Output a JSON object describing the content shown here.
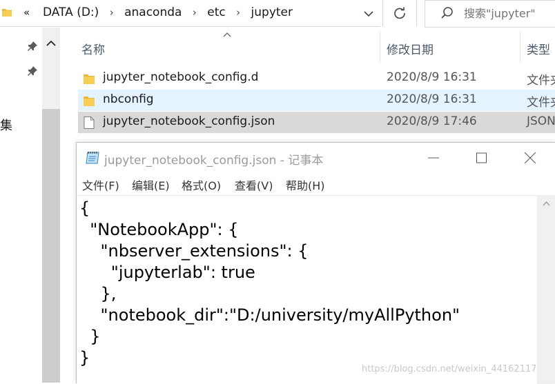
{
  "address_bar": {
    "overflow": "«",
    "path": [
      "DATA (D:)",
      "anaconda",
      "etc",
      "jupyter"
    ]
  },
  "search": {
    "placeholder": "搜索\"jupyter\""
  },
  "left_pane": {
    "label": "集"
  },
  "columns": {
    "name": "名称",
    "date": "修改日期",
    "type": "类型"
  },
  "files": [
    {
      "name": "jupyter_notebook_config.d",
      "date": "2020/8/9 16:31",
      "type": "文件夹",
      "icon": "folder-icon",
      "state": "normal"
    },
    {
      "name": "nbconfig",
      "date": "2020/8/9 16:31",
      "type": "文件夹",
      "icon": "folder-icon",
      "state": "selected"
    },
    {
      "name": "jupyter_notebook_config.json",
      "date": "2020/8/9 17:46",
      "type": "JSON",
      "icon": "file-icon",
      "state": "hover"
    }
  ],
  "notepad": {
    "title": "jupyter_notebook_config.json - 记事本",
    "menu": [
      "文件(F)",
      "编辑(E)",
      "格式(O)",
      "查看(V)",
      "帮助(H)"
    ],
    "content": [
      "{",
      "  \"NotebookApp\": {",
      "    \"nbserver_extensions\": {",
      "      \"jupyterlab\": true",
      "    },",
      "    \"notebook_dir\":\"D:/university/myAllPython\"",
      "  }",
      "}"
    ]
  },
  "watermark": "https://blog.csdn.net/weixin_44162117"
}
